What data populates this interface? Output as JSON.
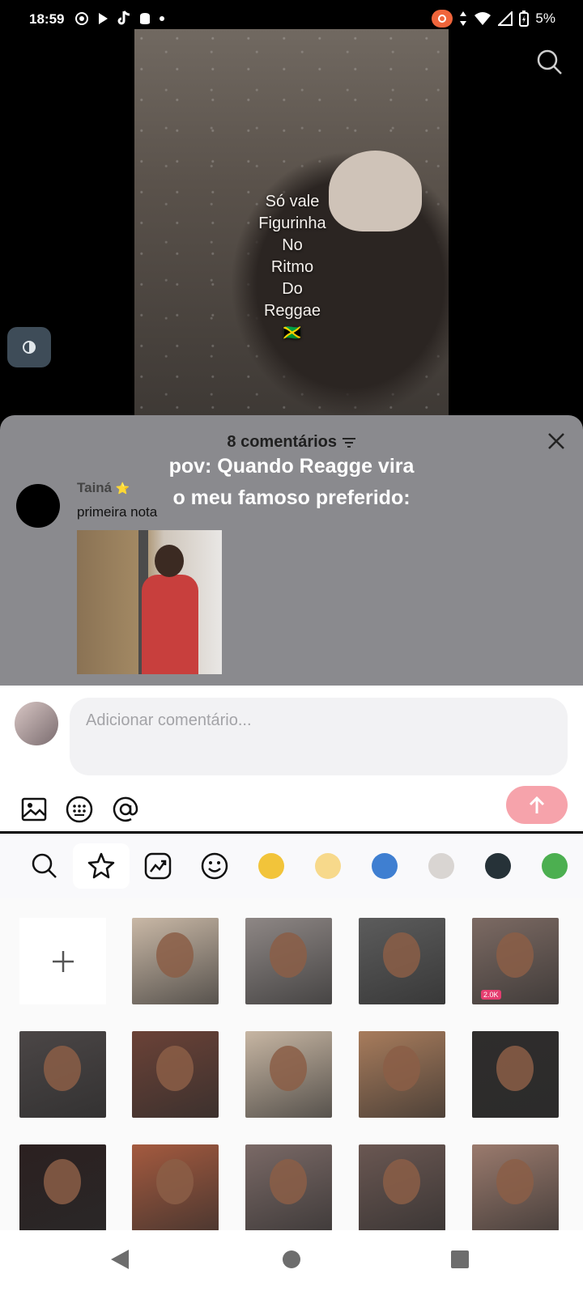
{
  "status_bar": {
    "time": "18:59",
    "battery": "5%"
  },
  "video": {
    "caption_lines": [
      "Só vale",
      "Figurinha",
      "No",
      "Ritmo",
      "Do",
      "Reggae"
    ],
    "flag": "🇯🇲"
  },
  "comments": {
    "header": "8 comentários",
    "overlay_line1": "pov: Quando Reagge vira",
    "overlay_line2": "o meu famoso preferido:",
    "items": [
      {
        "author": "Tainá",
        "badge": "⭐",
        "text": "primeira nota"
      }
    ]
  },
  "composer": {
    "placeholder": "Adicionar comentário..."
  },
  "sticker_tabs": [
    "search-icon",
    "star-icon",
    "trending-icon",
    "smiley-icon",
    "sticker-1",
    "sticker-2",
    "sticker-3",
    "sticker-4",
    "sticker-5",
    "sticker-6"
  ],
  "stickers": {
    "sticker_badge": "2.0K",
    "tiles": [
      {
        "row": 0,
        "col": 1,
        "color": "#c9b8a6"
      },
      {
        "row": 0,
        "col": 2,
        "color": "#8e8785"
      },
      {
        "row": 0,
        "col": 3,
        "color": "#5c5c5c"
      },
      {
        "row": 0,
        "col": 4,
        "color": "#7c6a63"
      },
      {
        "row": 1,
        "col": 0,
        "color": "#4b4646"
      },
      {
        "row": 1,
        "col": 1,
        "color": "#6b4237"
      },
      {
        "row": 1,
        "col": 2,
        "color": "#c7b6a3"
      },
      {
        "row": 1,
        "col": 3,
        "color": "#a87c5c"
      },
      {
        "row": 1,
        "col": 4,
        "color": "#2f2d2c"
      },
      {
        "row": 2,
        "col": 0,
        "color": "#2b2020"
      },
      {
        "row": 2,
        "col": 1,
        "color": "#a45a3f"
      },
      {
        "row": 2,
        "col": 2,
        "color": "#7a6966"
      },
      {
        "row": 2,
        "col": 3,
        "color": "#6a5752"
      },
      {
        "row": 2,
        "col": 4,
        "color": "#9a7a6d"
      }
    ]
  },
  "colors": {
    "accent": "#f6a3ab",
    "sheet": "#8a8a8e"
  }
}
